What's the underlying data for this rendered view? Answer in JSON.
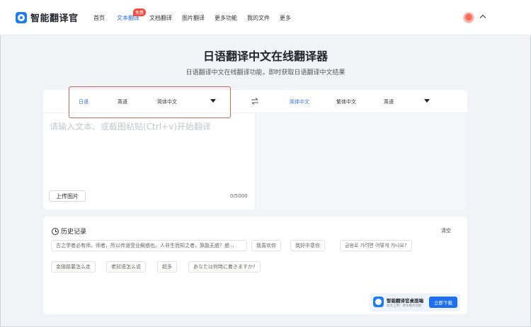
{
  "app": {
    "name": "智能翻译官"
  },
  "nav": {
    "items": [
      {
        "label": "首页"
      },
      {
        "label": "文本翻译",
        "badge": "免费"
      },
      {
        "label": "文档翻译"
      },
      {
        "label": "图片翻译"
      },
      {
        "label": "更多功能"
      },
      {
        "label": "我的文件"
      },
      {
        "label": "更多"
      }
    ],
    "active_index": 1
  },
  "hero": {
    "title": "日语翻译中文在线翻译器",
    "subtitle": "日语翻译中文在线翻译功能，即时获取日语翻译中文结果"
  },
  "translator": {
    "source_langs": [
      "日语",
      "英语",
      "简体中文"
    ],
    "target_langs": [
      "简体中文",
      "繁体中文",
      "英语"
    ],
    "source_active": "日语",
    "target_active": "简体中文",
    "input_placeholder": "请输入文本、或截图粘贴(Ctrl+v)开始翻译",
    "upload_label": "上传图片",
    "char_count": "0/5000"
  },
  "history": {
    "title": "历史记录",
    "clear_label": "清空",
    "items": [
      "古之学者必有师。师者，所以传道受业解惑也。人非生而知之者，孰能无惑？惑...",
      "我喜欢你",
      "我好中意你",
      "금용로 가려면 어떻게 가나요?",
      "金陵路要怎么走",
      "老挝语怎么说",
      "超多",
      "あなたは何時に着きますか?"
    ]
  },
  "promo": {
    "title": "智能翻译官桌面端",
    "subtitle": "高大上用，更多模式功能",
    "button": "立即下载"
  },
  "colors": {
    "accent": "#2a6ff0",
    "badge": "#f24c3d",
    "highlight": "#c9695c"
  }
}
